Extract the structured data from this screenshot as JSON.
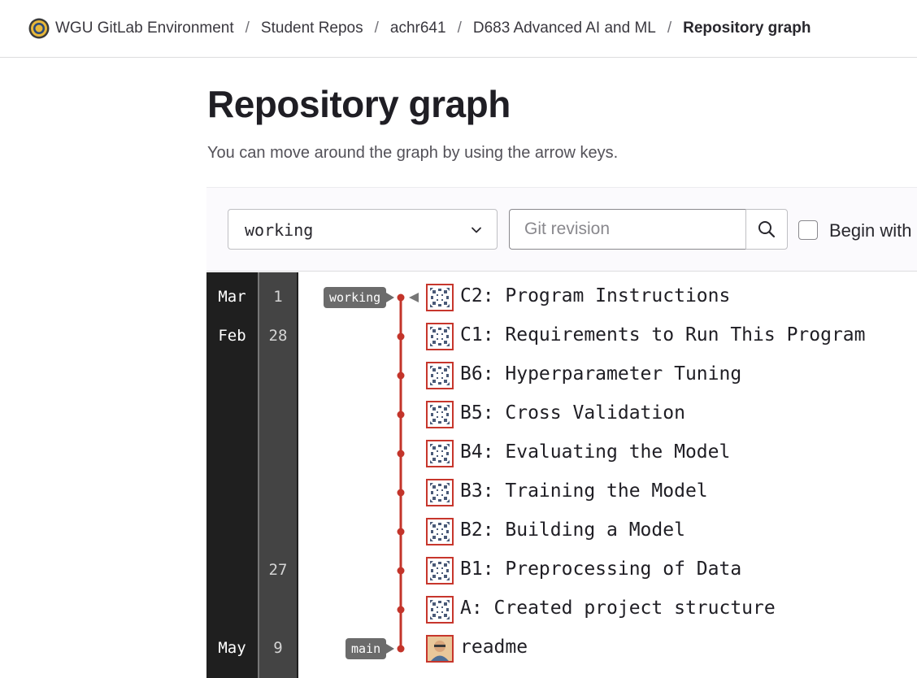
{
  "breadcrumb": [
    "WGU GitLab Environment",
    "Student Repos",
    "achr641",
    "D683 Advanced AI and ML",
    "Repository graph"
  ],
  "page": {
    "title": "Repository graph",
    "subtitle": "You can move around the graph by using the arrow keys."
  },
  "filters": {
    "branch": "working",
    "revision_placeholder": "Git revision",
    "checkbox_label": "Begin with"
  },
  "graph": {
    "dates": [
      {
        "month": "Mar",
        "day": "1"
      },
      {
        "month": "Feb",
        "day": "28"
      },
      {
        "month": "",
        "day": ""
      },
      {
        "month": "",
        "day": ""
      },
      {
        "month": "",
        "day": ""
      },
      {
        "month": "",
        "day": ""
      },
      {
        "month": "",
        "day": ""
      },
      {
        "month": "",
        "day": "27"
      },
      {
        "month": "",
        "day": ""
      },
      {
        "month": "May",
        "day": "9"
      }
    ],
    "commits": [
      {
        "message": "C2: Program Instructions",
        "ref": "working",
        "avatar": "identicon"
      },
      {
        "message": "C1: Requirements to Run This Program",
        "ref": "",
        "avatar": "identicon"
      },
      {
        "message": "B6: Hyperparameter Tuning",
        "ref": "",
        "avatar": "identicon"
      },
      {
        "message": "B5: Cross Validation",
        "ref": "",
        "avatar": "identicon"
      },
      {
        "message": "B4: Evaluating the Model",
        "ref": "",
        "avatar": "identicon"
      },
      {
        "message": "B3: Training the Model",
        "ref": "",
        "avatar": "identicon"
      },
      {
        "message": "B2: Building a Model",
        "ref": "",
        "avatar": "identicon"
      },
      {
        "message": "B1: Preprocessing of Data",
        "ref": "",
        "avatar": "identicon"
      },
      {
        "message": "A: Created project structure",
        "ref": "",
        "avatar": "identicon"
      },
      {
        "message": "readme",
        "ref": "main",
        "avatar": "user-photo"
      }
    ],
    "line_color": "#c3342a"
  }
}
